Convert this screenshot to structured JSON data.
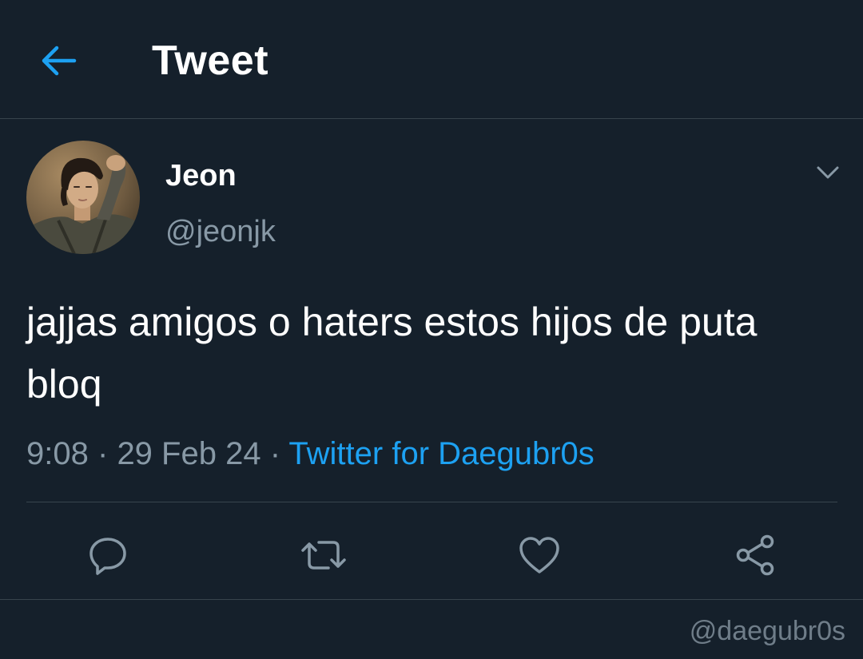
{
  "header": {
    "title": "Tweet",
    "back_icon": "arrow-left-icon"
  },
  "colors": {
    "background": "#15202b",
    "accent": "#1da1f2",
    "secondary_text": "#8899a6",
    "divider": "#38444d"
  },
  "author": {
    "name": "Jeon",
    "handle": "@jeonjk",
    "menu_icon": "chevron-down-icon"
  },
  "tweet": {
    "text": "jajjas amigos o haters estos hijos de puta bloq",
    "time": "9:08",
    "separator": "·",
    "date": "29 Feb 24",
    "source": "Twitter for Daegubr0s"
  },
  "actions": [
    {
      "icon": "reply-icon"
    },
    {
      "icon": "retweet-icon"
    },
    {
      "icon": "heart-icon"
    },
    {
      "icon": "share-icon"
    }
  ],
  "watermark": "@daegubr0s"
}
